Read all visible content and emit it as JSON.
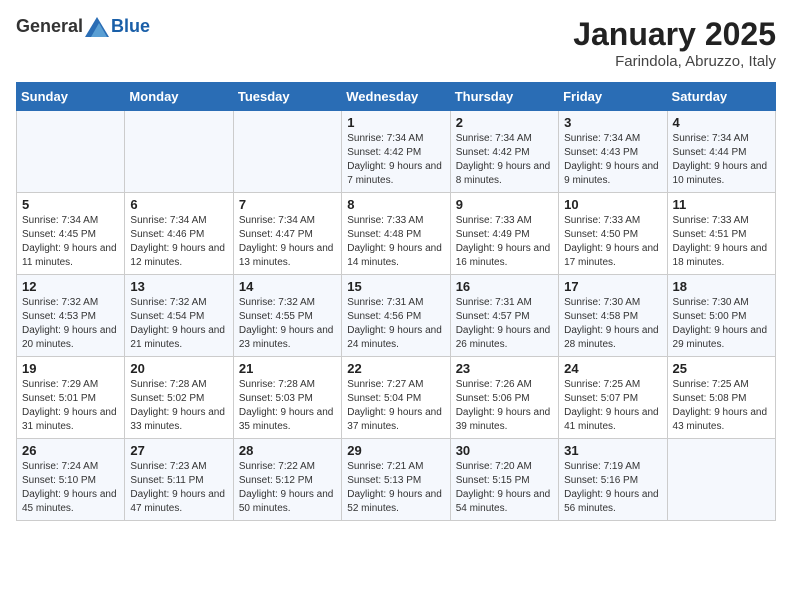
{
  "header": {
    "logo_general": "General",
    "logo_blue": "Blue",
    "month_title": "January 2025",
    "location": "Farindola, Abruzzo, Italy"
  },
  "weekdays": [
    "Sunday",
    "Monday",
    "Tuesday",
    "Wednesday",
    "Thursday",
    "Friday",
    "Saturday"
  ],
  "weeks": [
    [
      {
        "day": "",
        "info": ""
      },
      {
        "day": "",
        "info": ""
      },
      {
        "day": "",
        "info": ""
      },
      {
        "day": "1",
        "info": "Sunrise: 7:34 AM\nSunset: 4:42 PM\nDaylight: 9 hours and 7 minutes."
      },
      {
        "day": "2",
        "info": "Sunrise: 7:34 AM\nSunset: 4:42 PM\nDaylight: 9 hours and 8 minutes."
      },
      {
        "day": "3",
        "info": "Sunrise: 7:34 AM\nSunset: 4:43 PM\nDaylight: 9 hours and 9 minutes."
      },
      {
        "day": "4",
        "info": "Sunrise: 7:34 AM\nSunset: 4:44 PM\nDaylight: 9 hours and 10 minutes."
      }
    ],
    [
      {
        "day": "5",
        "info": "Sunrise: 7:34 AM\nSunset: 4:45 PM\nDaylight: 9 hours and 11 minutes."
      },
      {
        "day": "6",
        "info": "Sunrise: 7:34 AM\nSunset: 4:46 PM\nDaylight: 9 hours and 12 minutes."
      },
      {
        "day": "7",
        "info": "Sunrise: 7:34 AM\nSunset: 4:47 PM\nDaylight: 9 hours and 13 minutes."
      },
      {
        "day": "8",
        "info": "Sunrise: 7:33 AM\nSunset: 4:48 PM\nDaylight: 9 hours and 14 minutes."
      },
      {
        "day": "9",
        "info": "Sunrise: 7:33 AM\nSunset: 4:49 PM\nDaylight: 9 hours and 16 minutes."
      },
      {
        "day": "10",
        "info": "Sunrise: 7:33 AM\nSunset: 4:50 PM\nDaylight: 9 hours and 17 minutes."
      },
      {
        "day": "11",
        "info": "Sunrise: 7:33 AM\nSunset: 4:51 PM\nDaylight: 9 hours and 18 minutes."
      }
    ],
    [
      {
        "day": "12",
        "info": "Sunrise: 7:32 AM\nSunset: 4:53 PM\nDaylight: 9 hours and 20 minutes."
      },
      {
        "day": "13",
        "info": "Sunrise: 7:32 AM\nSunset: 4:54 PM\nDaylight: 9 hours and 21 minutes."
      },
      {
        "day": "14",
        "info": "Sunrise: 7:32 AM\nSunset: 4:55 PM\nDaylight: 9 hours and 23 minutes."
      },
      {
        "day": "15",
        "info": "Sunrise: 7:31 AM\nSunset: 4:56 PM\nDaylight: 9 hours and 24 minutes."
      },
      {
        "day": "16",
        "info": "Sunrise: 7:31 AM\nSunset: 4:57 PM\nDaylight: 9 hours and 26 minutes."
      },
      {
        "day": "17",
        "info": "Sunrise: 7:30 AM\nSunset: 4:58 PM\nDaylight: 9 hours and 28 minutes."
      },
      {
        "day": "18",
        "info": "Sunrise: 7:30 AM\nSunset: 5:00 PM\nDaylight: 9 hours and 29 minutes."
      }
    ],
    [
      {
        "day": "19",
        "info": "Sunrise: 7:29 AM\nSunset: 5:01 PM\nDaylight: 9 hours and 31 minutes."
      },
      {
        "day": "20",
        "info": "Sunrise: 7:28 AM\nSunset: 5:02 PM\nDaylight: 9 hours and 33 minutes."
      },
      {
        "day": "21",
        "info": "Sunrise: 7:28 AM\nSunset: 5:03 PM\nDaylight: 9 hours and 35 minutes."
      },
      {
        "day": "22",
        "info": "Sunrise: 7:27 AM\nSunset: 5:04 PM\nDaylight: 9 hours and 37 minutes."
      },
      {
        "day": "23",
        "info": "Sunrise: 7:26 AM\nSunset: 5:06 PM\nDaylight: 9 hours and 39 minutes."
      },
      {
        "day": "24",
        "info": "Sunrise: 7:25 AM\nSunset: 5:07 PM\nDaylight: 9 hours and 41 minutes."
      },
      {
        "day": "25",
        "info": "Sunrise: 7:25 AM\nSunset: 5:08 PM\nDaylight: 9 hours and 43 minutes."
      }
    ],
    [
      {
        "day": "26",
        "info": "Sunrise: 7:24 AM\nSunset: 5:10 PM\nDaylight: 9 hours and 45 minutes."
      },
      {
        "day": "27",
        "info": "Sunrise: 7:23 AM\nSunset: 5:11 PM\nDaylight: 9 hours and 47 minutes."
      },
      {
        "day": "28",
        "info": "Sunrise: 7:22 AM\nSunset: 5:12 PM\nDaylight: 9 hours and 50 minutes."
      },
      {
        "day": "29",
        "info": "Sunrise: 7:21 AM\nSunset: 5:13 PM\nDaylight: 9 hours and 52 minutes."
      },
      {
        "day": "30",
        "info": "Sunrise: 7:20 AM\nSunset: 5:15 PM\nDaylight: 9 hours and 54 minutes."
      },
      {
        "day": "31",
        "info": "Sunrise: 7:19 AM\nSunset: 5:16 PM\nDaylight: 9 hours and 56 minutes."
      },
      {
        "day": "",
        "info": ""
      }
    ]
  ]
}
